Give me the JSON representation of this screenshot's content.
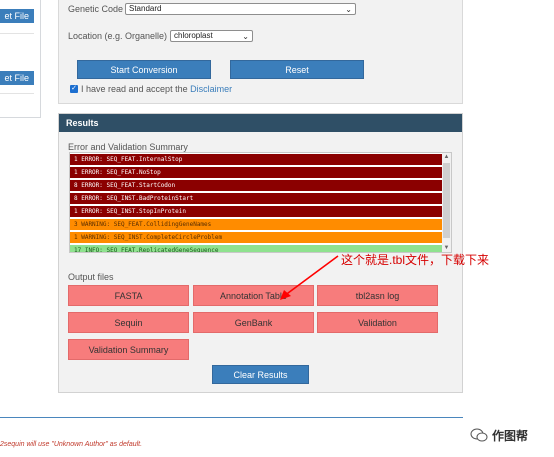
{
  "left_panel": {
    "button1_label": "et File",
    "button2_label": "et File"
  },
  "config": {
    "genetic_code_label": "Genetic Code",
    "genetic_code_value": "Standard",
    "location_label": "Location (e.g. Organelle)",
    "location_value": "chloroplast",
    "start_button": "Start Conversion",
    "reset_button": "Reset",
    "accept_text": "I have read and accept the",
    "disclaimer_link": "Disclaimer"
  },
  "results": {
    "header": "Results",
    "summary_label": "Error and Validation Summary",
    "log_rows": [
      {
        "text": "1 ERROR: SEQ_FEAT.InternalStop",
        "level": "error"
      },
      {
        "text": "1 ERROR: SEQ_FEAT.NoStop",
        "level": "error"
      },
      {
        "text": "8 ERROR: SEQ_FEAT.StartCodon",
        "level": "error"
      },
      {
        "text": "8 ERROR: SEQ_INST.BadProteinStart",
        "level": "error"
      },
      {
        "text": "1 ERROR: SEQ_INST.StopInProtein",
        "level": "error"
      },
      {
        "text": "3 WARNING: SEQ_FEAT.CollidingGeneNames",
        "level": "warning"
      },
      {
        "text": "1 WARNING: SEQ_INST.CompleteCircleProblem",
        "level": "warning"
      },
      {
        "text": "17 INFO: SEQ_FEAT.ReplicatedGeneSequence",
        "level": "info"
      }
    ],
    "output_label": "Output files",
    "outputs": {
      "fasta": "FASTA",
      "annotation_table": "Annotation Table",
      "tbl2asn_log": "tbl2asn log",
      "sequin": "Sequin",
      "genbank": "GenBank",
      "validation": "Validation",
      "validation_summary": "Validation Summary"
    },
    "clear_button": "Clear Results"
  },
  "annotation_text": "这个就是.tbl文件，下载下来",
  "footer_text": "2sequin will use \"Unknown Author\" as default.",
  "watermark_text": "作图帮",
  "colors": {
    "error": "#8b0000",
    "warning": "#ff8c00",
    "info": "#8fe28f",
    "header": "#2f4f66",
    "primary": "#3b7ebb",
    "output_button": "#f77c7c",
    "annotation": "#d60000"
  }
}
